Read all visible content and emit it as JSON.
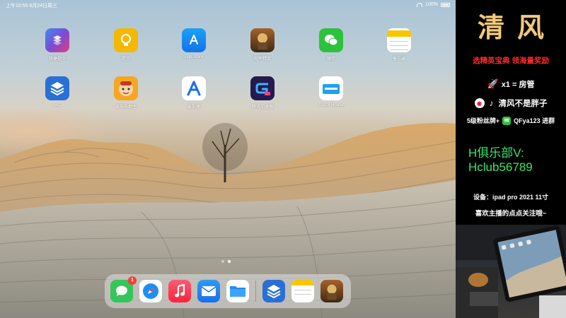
{
  "status_bar": {
    "time_date": "上午10:55  6月24日周三",
    "battery_percent": "100%"
  },
  "home_apps": [
    {
      "label": "快捷指令",
      "icon": "shortcuts-icon"
    },
    {
      "label": "提示",
      "icon": "tips-icon"
    },
    {
      "label": "App Store",
      "icon": "app-store-icon"
    },
    {
      "label": "和平精英",
      "icon": "game-icon"
    },
    {
      "label": "微信",
      "icon": "wechat-icon"
    },
    {
      "label": "备忘录",
      "icon": "notes-icon"
    },
    {
      "label": "IAC",
      "icon": "iac-icon"
    },
    {
      "label": "天乐乐地主",
      "icon": "cartoon-game-icon"
    },
    {
      "label": "爱加速",
      "icon": "a-launcher-icon"
    },
    {
      "label": "腾讯加速器",
      "icon": "game-box-icon"
    },
    {
      "label": "ASUS Router",
      "icon": "asus-router-icon"
    }
  ],
  "dock": {
    "messages_badge": "1",
    "apps": [
      "messages-icon",
      "safari-icon",
      "music-icon",
      "mail-icon",
      "files-icon",
      "iac-icon",
      "notes-icon",
      "game-icon"
    ]
  },
  "panel": {
    "title": "清风",
    "slogan": "选精英宝典 领海量奖励",
    "rocket_text": "x1 = 房管",
    "weibo_text": "清风不是胖子",
    "fans_text": "5级粉丝牌+",
    "wechat_text": "QFya123 进群",
    "hclub_label": "H俱乐部V:",
    "hclub_id": "Hclub56789",
    "device_text": "设备：ipad pro 2021 11寸",
    "follow_text": "喜欢主播的点点关注哦~",
    "colors": {
      "title": "#f3c97a",
      "slogan": "#ff2a2a",
      "hclub": "#39e66b"
    }
  }
}
